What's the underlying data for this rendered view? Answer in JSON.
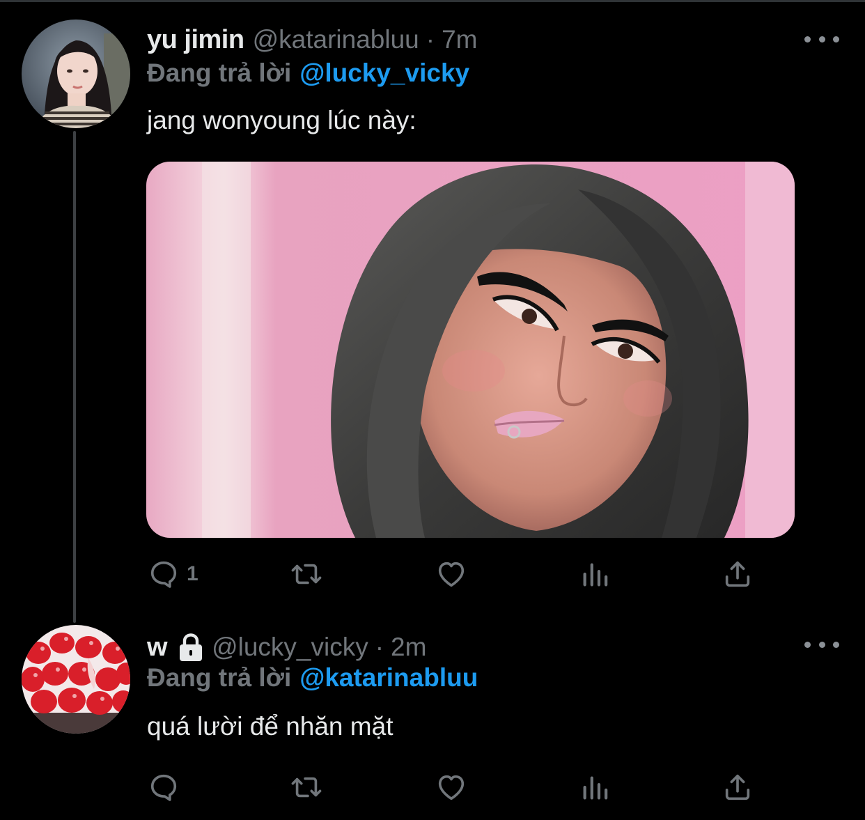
{
  "tweets": [
    {
      "display_name": "yu jimin",
      "handle": "@katarinabluu",
      "separator": "·",
      "time": "7m",
      "reply_prefix": "Đang trả lời",
      "reply_handle": "@lucky_vicky",
      "text": "jang wonyoung lúc này:",
      "has_media": true,
      "locked": false,
      "actions": {
        "reply_count": "1",
        "retweet_count": "",
        "like_count": "",
        "views_count": ""
      }
    },
    {
      "display_name": "w",
      "handle": "@lucky_vicky",
      "separator": "·",
      "time": "2m",
      "reply_prefix": "Đang trả lời",
      "reply_handle": "@katarinabluu",
      "text": "quá lười để nhăn mặt",
      "has_media": false,
      "locked": true,
      "actions": {
        "reply_count": "",
        "retweet_count": "",
        "like_count": "",
        "views_count": ""
      }
    }
  ],
  "icons": {
    "more": "more-horizontal-icon",
    "reply": "reply-bubble-icon",
    "retweet": "retweet-icon",
    "like": "heart-icon",
    "views": "views-bar-chart-icon",
    "share": "share-upload-icon",
    "lock": "lock-icon"
  },
  "colors": {
    "background": "#000000",
    "primary_text": "#e7e9ea",
    "secondary_text": "#71767b",
    "link": "#1d9bf0",
    "thread_line": "#3d4043"
  }
}
